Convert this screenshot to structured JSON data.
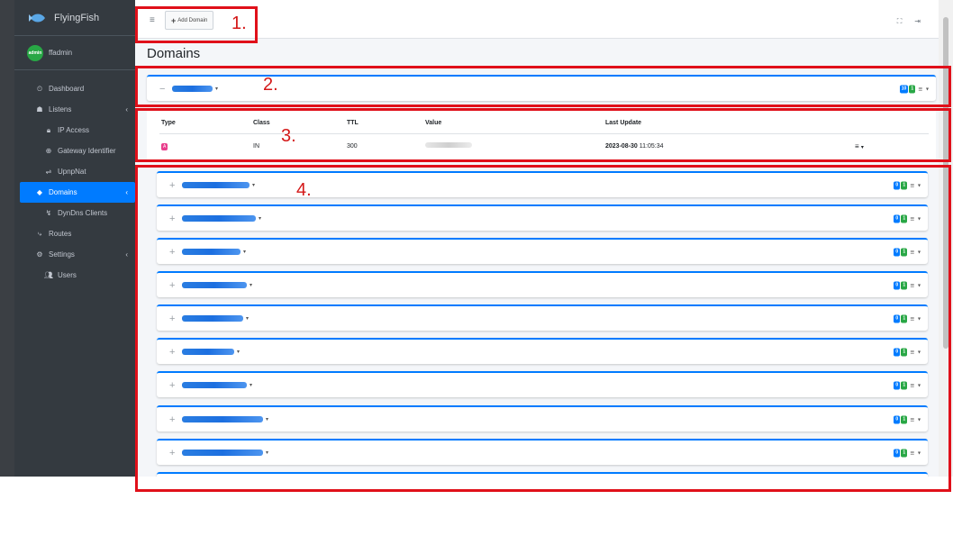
{
  "app": {
    "brand": "FlyingFish",
    "user": "ffadmin",
    "avatar_text": "admin"
  },
  "sidebar": {
    "items": [
      {
        "label": "Dashboard",
        "icon": "dashboard-icon",
        "glyph": "⏲"
      },
      {
        "label": "Listens",
        "icon": "listens-icon",
        "glyph": "☗",
        "chevron": "‹"
      },
      {
        "label": "IP Access",
        "icon": "lock-icon",
        "glyph": "🔒︎"
      },
      {
        "label": "Gateway Identifier",
        "icon": "globe-icon",
        "glyph": "⊕"
      },
      {
        "label": "UpnpNat",
        "icon": "signpost-icon",
        "glyph": "⇌"
      },
      {
        "label": "Domains",
        "icon": "tags-icon",
        "glyph": "◆",
        "chevron": "‹"
      },
      {
        "label": "DynDns Clients",
        "icon": "satellite-icon",
        "glyph": "↯"
      },
      {
        "label": "Routes",
        "icon": "routes-icon",
        "glyph": "⤷"
      },
      {
        "label": "Settings",
        "icon": "cogs-icon",
        "glyph": "⚙",
        "chevron": "‹"
      },
      {
        "label": "Users",
        "icon": "users-icon",
        "glyph": "👥︎"
      }
    ],
    "active": "Domains"
  },
  "topbar": {
    "menu_glyph": "≡",
    "add_glyph": "+",
    "add_label": "Add Domain",
    "fullscreen_glyph": "⛶",
    "logout_glyph": "⇥"
  },
  "page": {
    "title": "Domains"
  },
  "expanded_domain": {
    "toggle": "−",
    "caret": "▾",
    "badge_count": "10",
    "badge_active": "1",
    "menu_glyph": "≡",
    "menu_caret": "▾"
  },
  "records": {
    "headers": {
      "type": "Type",
      "class": "Class",
      "ttl": "TTL",
      "value": "Value",
      "last_update": "Last Update"
    },
    "row": {
      "type": "A",
      "class": "IN",
      "ttl": "300",
      "date": "2023-08-30",
      "time": "11:05:34",
      "menu_glyph": "≡",
      "menu_caret": "▾"
    }
  },
  "domains": [
    {
      "toggle": "+",
      "caret": "▾",
      "badge_count": "0",
      "badge_active": "1"
    },
    {
      "toggle": "+",
      "caret": "▾",
      "badge_count": "0",
      "badge_active": "1"
    },
    {
      "toggle": "+",
      "caret": "▾",
      "badge_count": "0",
      "badge_active": "1"
    },
    {
      "toggle": "+",
      "caret": "▾",
      "badge_count": "0",
      "badge_active": "1"
    },
    {
      "toggle": "+",
      "caret": "▾",
      "badge_count": "0",
      "badge_active": "1"
    },
    {
      "toggle": "+",
      "caret": "▾",
      "badge_count": "0",
      "badge_active": "1"
    },
    {
      "toggle": "+",
      "caret": "▾",
      "badge_count": "0",
      "badge_active": "1"
    },
    {
      "toggle": "+",
      "caret": "▾",
      "badge_count": "0",
      "badge_active": "1"
    },
    {
      "toggle": "+",
      "caret": "▾",
      "badge_count": "0",
      "badge_active": "1"
    }
  ],
  "annotations": [
    "1.",
    "2.",
    "3.",
    "4."
  ],
  "colors": {
    "accent": "#007bff",
    "annotation": "#e0101a",
    "badge_green": "#28a745",
    "type_badge": "#e83e8c",
    "sidebar": "#343a40"
  }
}
